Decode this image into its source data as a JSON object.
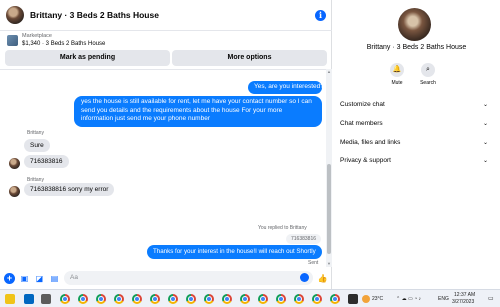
{
  "chat": {
    "title": "Brittany · 3 Beds 2 Baths House",
    "info_icon": "i",
    "marketplace": {
      "source": "Marketplace",
      "price_title": "$1,340 · 3 Beds 2 Baths House"
    },
    "buttons": {
      "pending": "Mark as pending",
      "more": "More options"
    },
    "messages": {
      "out1": "Yes, are you interested?",
      "out2": "yes the house is still available for rent, let me have your contact number so I can send you details and the requirements about the house For  your  more  information  just  send  me  your  phone  number",
      "sender1": "Brittany",
      "in1": "Sure",
      "in2": "716383816",
      "sender2": "Brittany",
      "in3": "7163838816 sorry my error",
      "reply_note": "You replied to Brittany",
      "quoted": "716383816",
      "out3": "Thanks for your interest in the house!I will reach out Shortly",
      "sent": "Sent"
    },
    "composer": {
      "placeholder": "Aa"
    }
  },
  "panel": {
    "name": "Brittany · 3 Beds 2 Baths House",
    "actions": {
      "mute": "Mute",
      "search": "Search"
    },
    "rows": [
      "Customize chat",
      "Chat members",
      "Media, files and links",
      "Privacy & support"
    ]
  },
  "taskbar": {
    "weather": "23°C",
    "lang": "ENG",
    "time": "12:37 AM",
    "date": "3/27/2023"
  },
  "colors": {
    "accent": "#0866ff",
    "bubble_out": "#0a7cff",
    "bubble_in": "#e4e6eb"
  }
}
